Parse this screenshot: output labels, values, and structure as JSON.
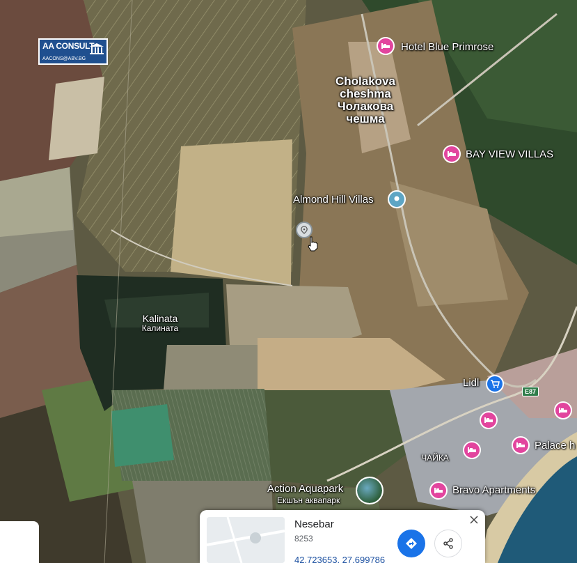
{
  "logo": {
    "title": "AA CONSULT",
    "subtitle": "AACONS@ABV.BG"
  },
  "places": [
    {
      "id": "cholakova",
      "lines": [
        "Cholakova",
        "cheshma",
        "Чолакова",
        "чешма"
      ]
    },
    {
      "id": "kalinata",
      "lines": [
        "Kalinata",
        "Калината"
      ]
    },
    {
      "id": "chayka",
      "lines": [
        "ЧАЙКА"
      ]
    }
  ],
  "pois": {
    "hotel_blue_primrose": "Hotel Blue Primrose",
    "bay_view_villas": "BAY VIEW VILLAS",
    "almond_hill_villas": "Almond Hill Villas",
    "lidl": "Lidl",
    "palace": "Palace h",
    "bravo_apartments": "Bravo Apartments",
    "action_aquapark": "Action Aquapark",
    "action_aquapark_bg": "Екшън аквапарк"
  },
  "road_shield": "E87",
  "info_card": {
    "title": "Nesebar",
    "postal_code": "8253",
    "coordinates": "42.723653, 27.699786"
  },
  "icons": {
    "hotel": "bed-icon",
    "shop": "shopping-cart-icon",
    "dropped": "map-pin-icon",
    "directions": "directions-icon",
    "share": "share-icon",
    "close": "close-icon"
  },
  "colors": {
    "hotel_pin": "#e2459e",
    "shop_pin": "#1a73e8",
    "attraction_pin": "#5da5c4",
    "logo_bg": "#1f4f8f"
  }
}
